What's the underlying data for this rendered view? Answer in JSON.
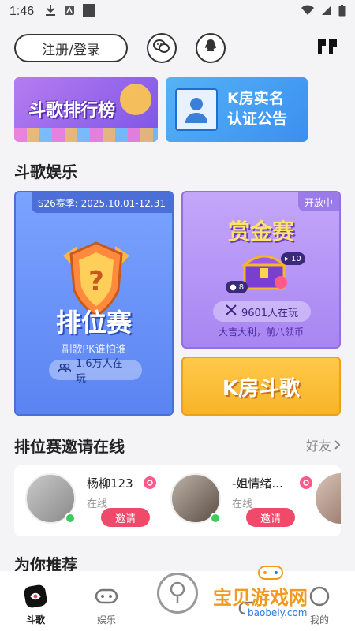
{
  "status_bar": {
    "time": "1:46"
  },
  "top": {
    "login_label": "注册/登录",
    "wechat_icon": "wechat-icon",
    "qq_icon": "qq-icon",
    "logo_icon": "app-logo"
  },
  "banners": {
    "rank": "斗歌排行榜",
    "kroom_line1": "K房实名",
    "kroom_line2": "认证公告"
  },
  "section_entertainment": "斗歌娱乐",
  "ranked": {
    "season": "S26赛季: 2025.10.01-12.31",
    "title": "排位赛",
    "subtitle": "副歌PK谁怕谁",
    "players": "1.6万人在玩"
  },
  "bounty": {
    "tag": "开放中",
    "title": "赏金赛",
    "badge_top": "10",
    "badge_left": "8",
    "players": "9601人在玩",
    "subtitle": "大吉大利，前八领币"
  },
  "kroom": {
    "title": "K房斗歌"
  },
  "invite_section": {
    "title": "排位赛邀请在线",
    "more": "好友",
    "friends": [
      {
        "name": "杨柳123",
        "status": "在线",
        "button": "邀请"
      },
      {
        "name": "-姐情绪...",
        "status": "在线",
        "button": "邀请"
      }
    ]
  },
  "recommend_title": "为你推荐",
  "tabbar": [
    {
      "label": "斗歌"
    },
    {
      "label": "娱乐"
    },
    {
      "label": ""
    },
    {
      "label": ""
    },
    {
      "label": "我的"
    }
  ],
  "watermark": {
    "text": "宝贝游戏网",
    "url": "baobeiy.com"
  }
}
